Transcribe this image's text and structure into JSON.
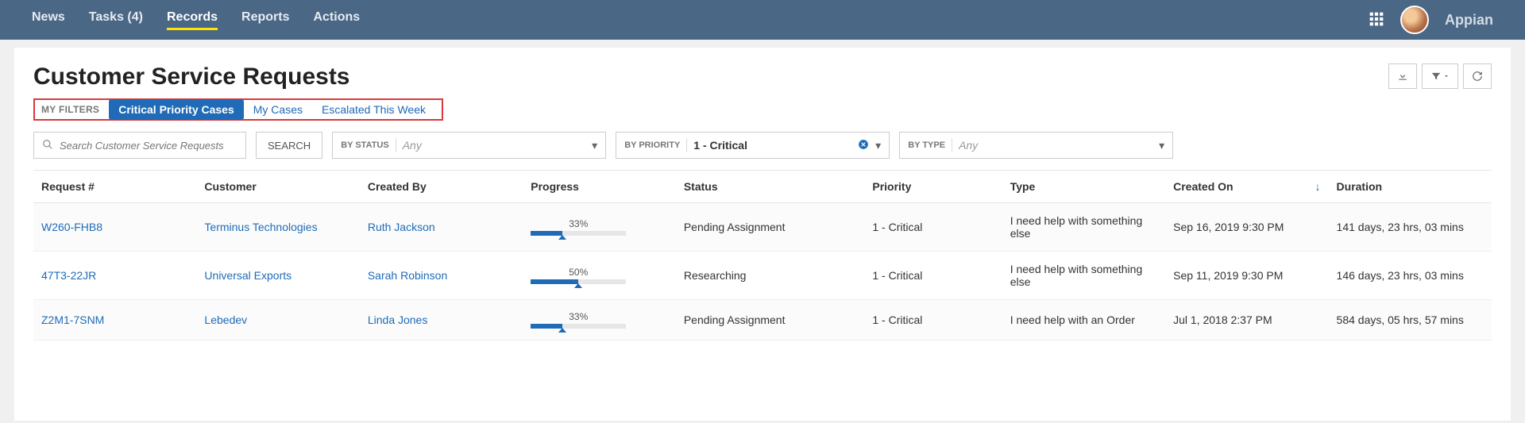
{
  "nav": {
    "items": [
      {
        "label": "News",
        "active": false
      },
      {
        "label": "Tasks (4)",
        "active": false
      },
      {
        "label": "Records",
        "active": true
      },
      {
        "label": "Reports",
        "active": false
      },
      {
        "label": "Actions",
        "active": false
      }
    ],
    "brand": "Appian"
  },
  "page": {
    "title": "Customer Service Requests"
  },
  "filters": {
    "label": "MY FILTERS",
    "items": [
      {
        "label": "Critical Priority Cases",
        "active": true
      },
      {
        "label": "My Cases",
        "active": false
      },
      {
        "label": "Escalated This Week",
        "active": false
      }
    ]
  },
  "search": {
    "placeholder": "Search Customer Service Requests",
    "button": "SEARCH"
  },
  "dropdowns": {
    "status": {
      "label": "BY STATUS",
      "value": "",
      "placeholder": "Any"
    },
    "priority": {
      "label": "BY PRIORITY",
      "value": "1 - Critical",
      "placeholder": ""
    },
    "type": {
      "label": "BY TYPE",
      "value": "",
      "placeholder": "Any"
    }
  },
  "table": {
    "columns": [
      "Request #",
      "Customer",
      "Created By",
      "Progress",
      "Status",
      "Priority",
      "Type",
      "Created On",
      "Duration"
    ],
    "sort_column": "Created On",
    "sort_dir": "desc",
    "rows": [
      {
        "request": "W260-FHB8",
        "customer": "Terminus Technologies",
        "created_by": "Ruth Jackson",
        "progress": 33,
        "progress_label": "33%",
        "status": "Pending Assignment",
        "priority": "1 - Critical",
        "type": "I need help with something else",
        "created_on": "Sep 16, 2019 9:30 PM",
        "duration": "141 days, 23 hrs, 03 mins"
      },
      {
        "request": "47T3-22JR",
        "customer": "Universal Exports",
        "created_by": "Sarah Robinson",
        "progress": 50,
        "progress_label": "50%",
        "status": "Researching",
        "priority": "1 - Critical",
        "type": "I need help with something else",
        "created_on": "Sep 11, 2019 9:30 PM",
        "duration": "146 days, 23 hrs, 03 mins"
      },
      {
        "request": "Z2M1-7SNM",
        "customer": "Lebedev",
        "created_by": "Linda Jones",
        "progress": 33,
        "progress_label": "33%",
        "status": "Pending Assignment",
        "priority": "1 - Critical",
        "type": "I need help with an Order",
        "created_on": "Jul 1, 2018 2:37 PM",
        "duration": "584 days, 05 hrs, 57 mins"
      }
    ]
  }
}
